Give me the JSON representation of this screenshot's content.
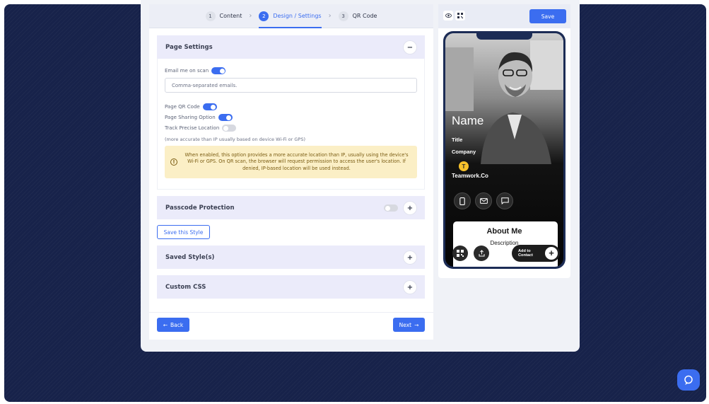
{
  "stepper": {
    "steps": [
      {
        "num": "1",
        "label": "Content"
      },
      {
        "num": "2",
        "label": "Design / Settings"
      },
      {
        "num": "3",
        "label": "QR Code"
      }
    ],
    "active_step": 2
  },
  "page_settings": {
    "title": "Page Settings",
    "collapse_symbol": "−",
    "email_me_on_scan_label": "Email me on scan",
    "email_me_on_scan_enabled": true,
    "emails_placeholder": "Comma-separated emails.",
    "page_qr_code_label": "Page QR Code",
    "page_qr_code_enabled": true,
    "page_sharing_label": "Page Sharing Option",
    "page_sharing_enabled": true,
    "track_location_label": "Track Precise Location",
    "track_location_enabled": false,
    "track_location_note": "(more accurate than IP usually based on device Wi-Fi or GPS)",
    "alert_text": "When enabled, this option provides a more accurate location than IP, usually using the device's Wi-Fi or GPS. On QR scan, the browser will request permission to access the user's location. If denied, IP-based location will be used instead."
  },
  "passcode": {
    "title": "Passcode Protection",
    "enabled": false,
    "expand_symbol": "+"
  },
  "save_style_label": "Save this Style",
  "saved_styles": {
    "title": "Saved Style(s)",
    "expand_symbol": "+"
  },
  "custom_css": {
    "title": "Custom CSS",
    "expand_symbol": "+"
  },
  "back_label": "Back",
  "next_label": "Next",
  "toolbar": {
    "save_label": "Save",
    "preview_icon": "eye-icon",
    "qr_icon": "qr-code-icon"
  },
  "preview": {
    "name": "Name",
    "title": "Title",
    "company": "Company",
    "logo_letter": "T",
    "brand": "Teamwork.Co",
    "about_title": "About Me",
    "about_desc": "Description",
    "add_to_contact_line1": "Add to",
    "add_to_contact_line2": "Contact"
  },
  "colors": {
    "accent": "#3b6df0",
    "backdrop": "#17224a",
    "alert_bg": "#fbefc6",
    "logo": "#f7c12b"
  }
}
